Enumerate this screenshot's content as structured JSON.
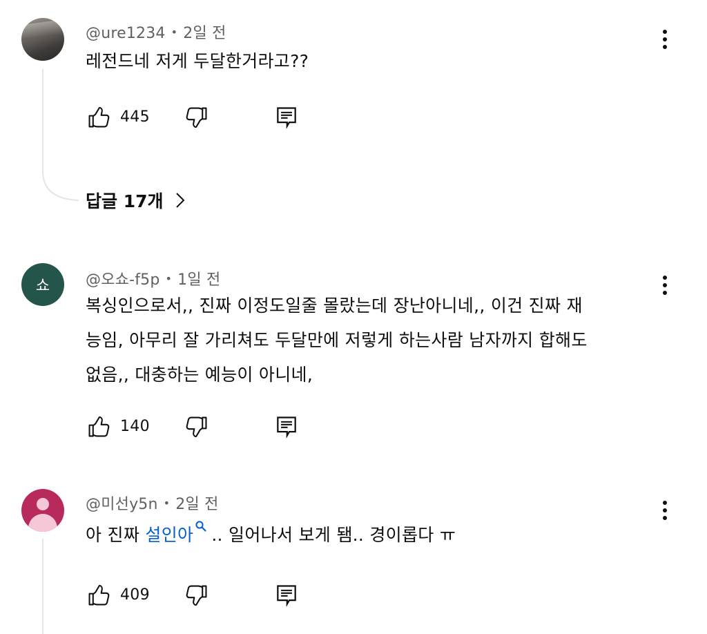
{
  "comments": [
    {
      "author": "@ure1234",
      "time": "2일 전",
      "text_lines": [
        "레전드네 저게 두달한거라고??"
      ],
      "likes": "445",
      "avatar": "photo",
      "replies_label": "답글 17개"
    },
    {
      "author": "@오쇼-f5p",
      "time": "1일 전",
      "avatar_letter": "쇼",
      "avatar_color": "#24554a",
      "text_lines": [
        "복싱인으로서,, 진짜 이정도일줄 몰랐는데 장난아니네,, 이건 진짜 재",
        "능임, 아무리 잘 가리쳐도 두달만에 저렇게 하는사람 남자까지 합해도",
        "없음,, 대충하는 예능이 아니네,"
      ],
      "likes": "140"
    },
    {
      "author": "@미선y5n",
      "time": "2일 전",
      "avatar_color": "#b8295c",
      "text_before": "아 진짜 ",
      "text_link": "설인아",
      "text_after": ".. 일어나서 보게 됌.. 경이롭다 ㅠ",
      "likes": "409"
    }
  ],
  "colors": {
    "link": "#065fd4",
    "meta": "#606060",
    "thread_line": "#e5e5e5"
  },
  "icons": {
    "like": "thumbs-up-icon",
    "dislike": "thumbs-down-icon",
    "reply": "reply-comment-icon",
    "more": "more-vertical-icon",
    "chevron": "chevron-right-icon",
    "link_search": "search-icon"
  }
}
